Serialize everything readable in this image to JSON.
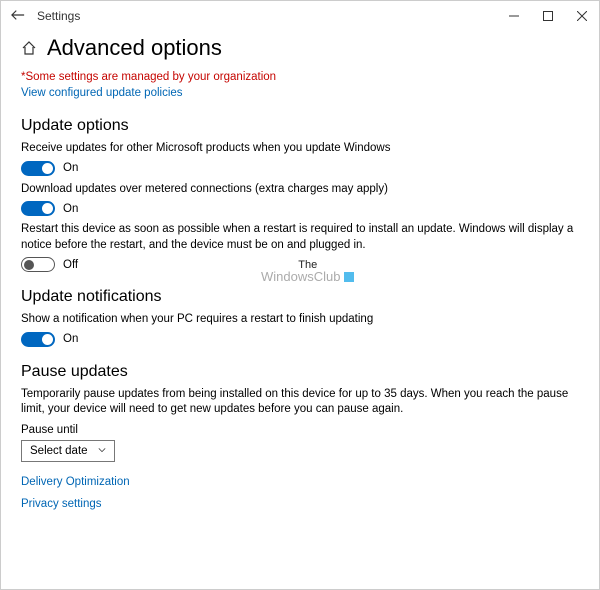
{
  "window": {
    "title": "Settings"
  },
  "page": {
    "title": "Advanced options",
    "orgMessage": "*Some settings are managed by your organization",
    "policyLink": "View configured update policies"
  },
  "sections": {
    "updateOptions": {
      "title": "Update options",
      "opt1": {
        "label": "Receive updates for other Microsoft products when you update Windows",
        "state": "On",
        "on": true
      },
      "opt2": {
        "label": "Download updates over metered connections (extra charges may apply)",
        "state": "On",
        "on": true
      },
      "opt3": {
        "label": "Restart this device as soon as possible when a restart is required to install an update. Windows will display a notice before the restart, and the device must be on and plugged in.",
        "state": "Off",
        "on": false
      }
    },
    "updateNotifications": {
      "title": "Update notifications",
      "opt1": {
        "label": "Show a notification when your PC requires a restart to finish updating",
        "state": "On",
        "on": true
      }
    },
    "pauseUpdates": {
      "title": "Pause updates",
      "desc": "Temporarily pause updates from being installed on this device for up to 35 days. When you reach the pause limit, your device will need to get new updates before you can pause again.",
      "pauseLabel": "Pause until",
      "dropdown": "Select date"
    }
  },
  "footer": {
    "delivery": "Delivery Optimization",
    "privacy": "Privacy settings"
  },
  "watermark": {
    "line1": "The",
    "line2": "WindowsClub"
  }
}
